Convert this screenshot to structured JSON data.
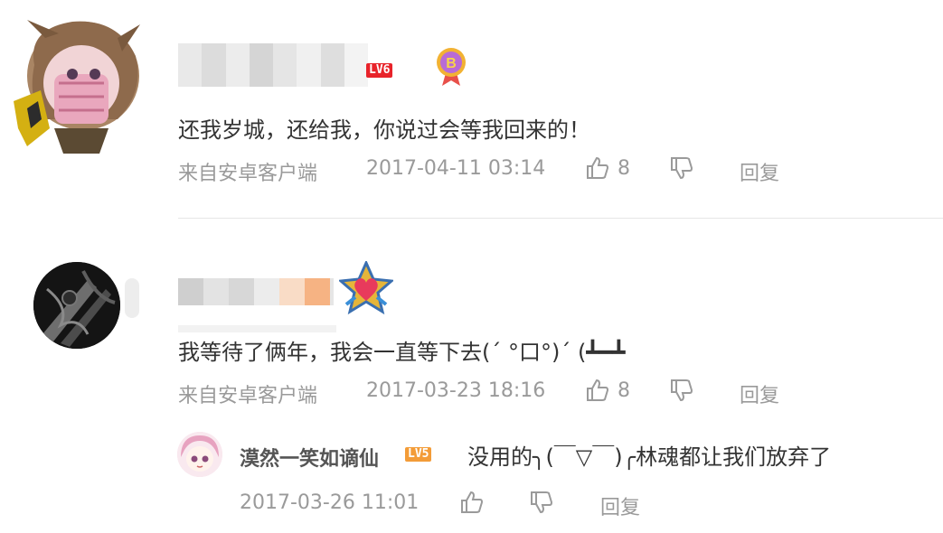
{
  "comments": [
    {
      "level": "LV6",
      "badge_icon": "medal-b-icon",
      "text": "还我岁城，还给我，你说过会等我回来的！",
      "source": "来自安卓客户端",
      "time": "2017-04-11 03:14",
      "likes": "8",
      "reply_label": "回复"
    },
    {
      "badge_icon": "heart-star-icon",
      "text": "我等待了俩年，我会一直等下去(ˊ °口°)ˊ (┻━┻",
      "source": "来自安卓客户端",
      "time": "2017-03-23 18:16",
      "likes": "8",
      "reply_label": "回复",
      "reply": {
        "username": "漠然一笑如谪仙",
        "level": "LV5",
        "text": "没用的╮(￣▽￣)╭林魂都让我们放弃了",
        "time": "2017-03-26 11:01",
        "reply_label": "回复"
      }
    }
  ],
  "colors": {
    "level6": "#e8232a",
    "level5": "#f39c38",
    "meta": "#9a9a9a",
    "text": "#333333"
  }
}
